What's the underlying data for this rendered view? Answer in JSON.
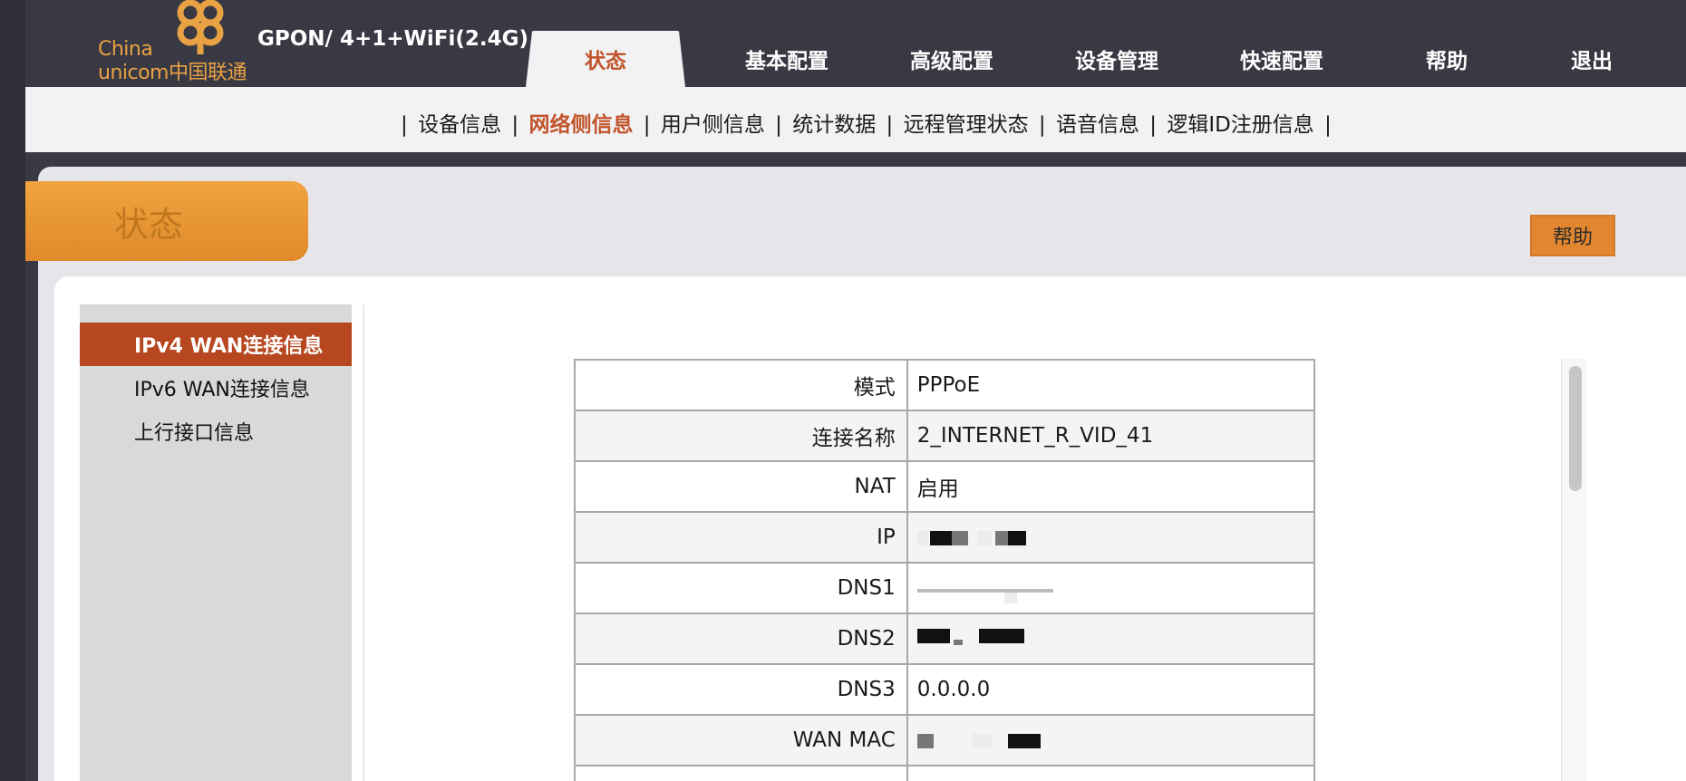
{
  "header": {
    "logo_line1": "China",
    "logo_line2": "unicom中国联通",
    "product": "GPON/ 4+1+WiFi(2.4G)"
  },
  "nav": [
    {
      "label": "状态",
      "active": true
    },
    {
      "label": "基本配置"
    },
    {
      "label": "高级配置"
    },
    {
      "label": "设备管理"
    },
    {
      "label": "快速配置"
    },
    {
      "label": "帮助"
    },
    {
      "label": "退出"
    }
  ],
  "subnav": [
    {
      "label": "设备信息"
    },
    {
      "label": "网络侧信息",
      "active": true
    },
    {
      "label": "用户侧信息"
    },
    {
      "label": "统计数据"
    },
    {
      "label": "远程管理状态"
    },
    {
      "label": "语音信息"
    },
    {
      "label": "逻辑ID注册信息"
    }
  ],
  "page": {
    "title": "状态",
    "help_button": "帮助"
  },
  "sidebar": [
    {
      "label": "IPv4 WAN连接信息",
      "active": true
    },
    {
      "label": "IPv6 WAN连接信息"
    },
    {
      "label": "上行接口信息"
    }
  ],
  "table": [
    {
      "label": "模式",
      "value": "PPPoE"
    },
    {
      "label": "连接名称",
      "value": "2_INTERNET_R_VID_41"
    },
    {
      "label": "NAT",
      "value": "启用"
    },
    {
      "label": "IP",
      "value": ""
    },
    {
      "label": "DNS1",
      "value": ""
    },
    {
      "label": "DNS2",
      "value": ""
    },
    {
      "label": "DNS3",
      "value": "0.0.0.0"
    },
    {
      "label": "WAN MAC",
      "value": ""
    },
    {
      "label": "",
      "value": ""
    }
  ],
  "colors": {
    "accent": "#c0542a",
    "header_bg": "#393944",
    "tab_orange": "#e9a243"
  }
}
